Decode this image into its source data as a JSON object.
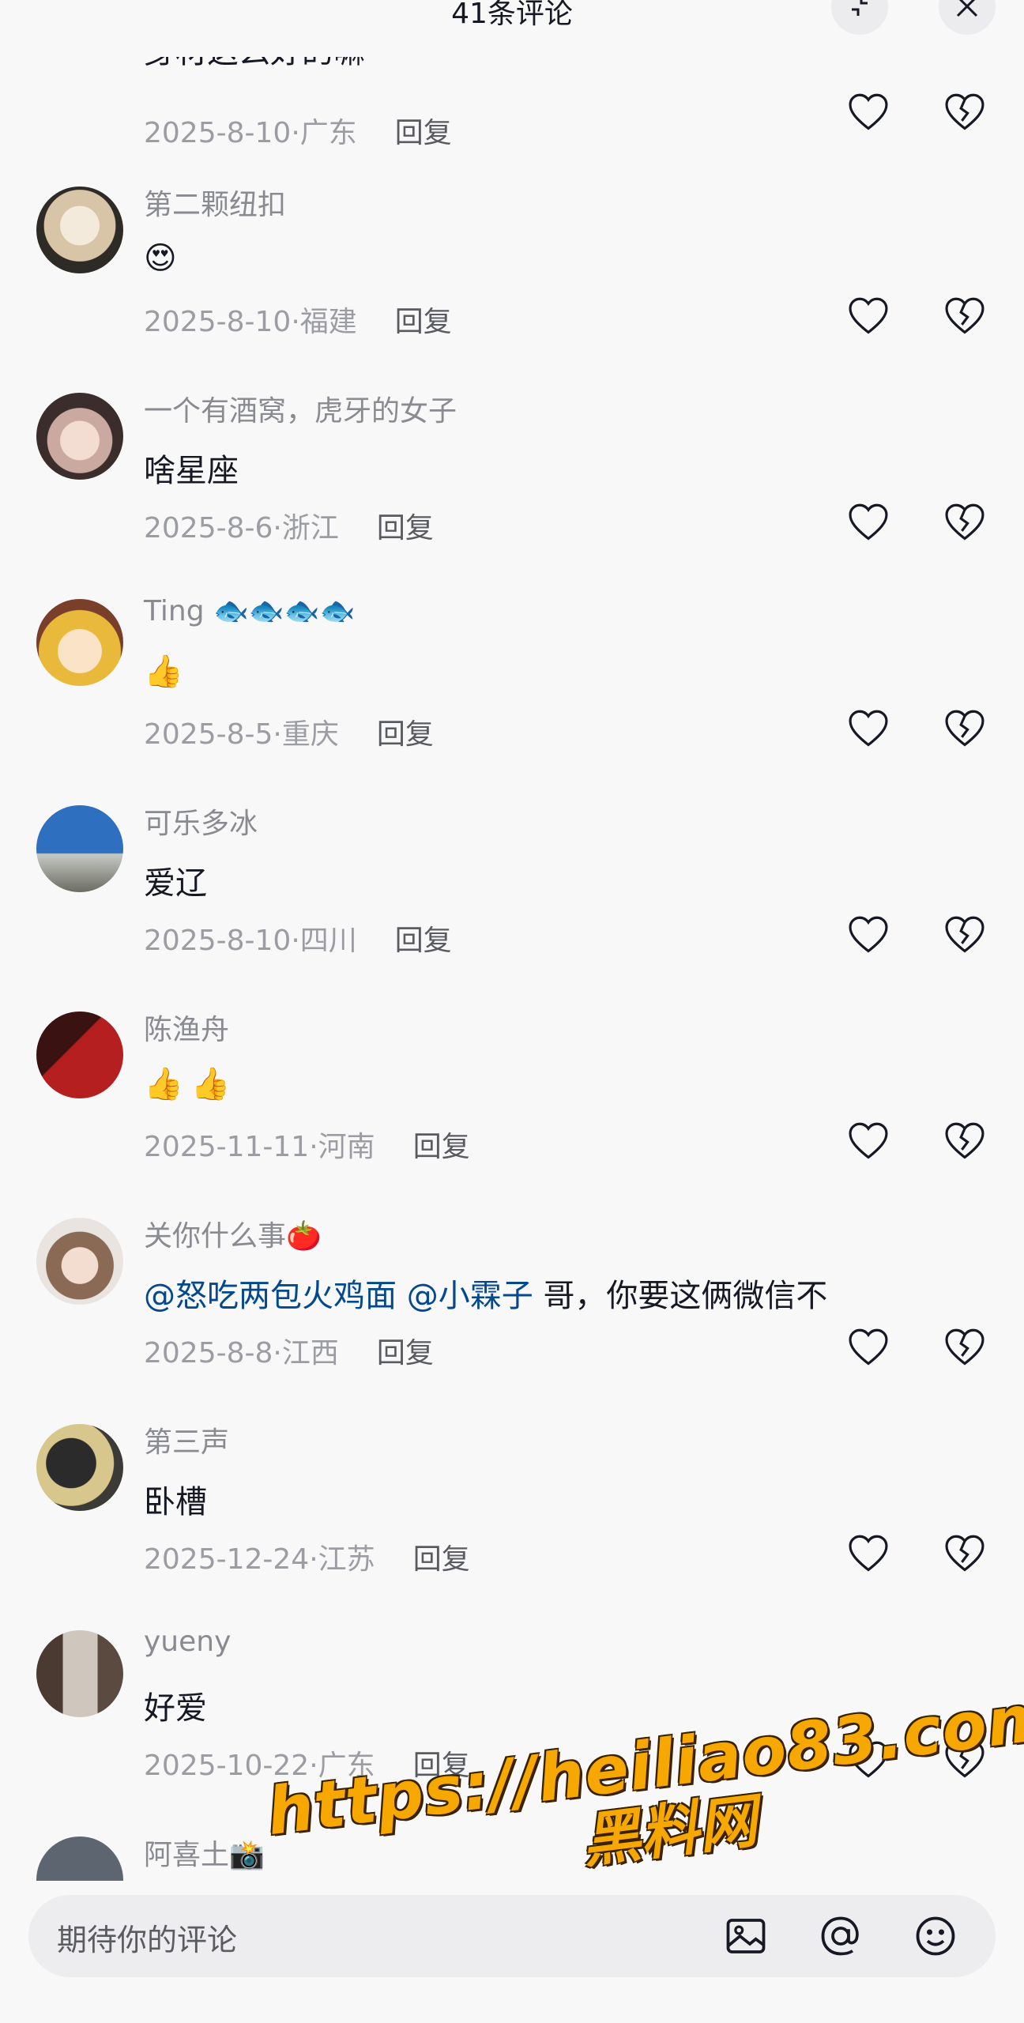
{
  "header": {
    "title": "41条评论"
  },
  "comments": [
    {
      "name": "",
      "text": "身材这么好的嘛",
      "date": "2025-8-10",
      "region": "广东",
      "reply": "回复"
    },
    {
      "name": "第二颗纽扣",
      "text": "",
      "emojis": [
        "😍"
      ],
      "date": "2025-8-10",
      "region": "福建",
      "reply": "回复"
    },
    {
      "name": "一个有酒窝，虎牙的女子",
      "text": "啥星座",
      "date": "2025-8-6",
      "region": "浙江",
      "reply": "回复"
    },
    {
      "name": "Ting 🐟🐟🐟🐟",
      "text": "",
      "emojis": [
        "👍"
      ],
      "date": "2025-8-5",
      "region": "重庆",
      "reply": "回复"
    },
    {
      "name": "可乐多冰",
      "text": "爱辽",
      "date": "2025-8-10",
      "region": "四川",
      "reply": "回复"
    },
    {
      "name": "陈渔舟",
      "text": "",
      "emojis": [
        "👍",
        "👍"
      ],
      "date": "2025-11-11",
      "region": "河南",
      "reply": "回复"
    },
    {
      "name": "关你什么事🍅",
      "mention1": "@怒吃两包火鸡面",
      "mention2": "@小霖子",
      "text": "哥，你要这俩微信不",
      "date": "2025-8-8",
      "region": "江西",
      "reply": "回复"
    },
    {
      "name": "第三声",
      "text": "卧槽",
      "date": "2025-12-24",
      "region": "江苏",
      "reply": "回复"
    },
    {
      "name": "yueny",
      "text": "好爱",
      "date": "2025-10-22",
      "region": "广东",
      "reply": "回复"
    },
    {
      "name": "阿喜土📸",
      "text": "",
      "date": "",
      "region": "",
      "reply": ""
    }
  ],
  "input": {
    "placeholder": "期待你的评论"
  },
  "watermark": {
    "url": "https://heiliao83.com",
    "name": "黑料网"
  },
  "colors": {
    "mention": "#04498d",
    "background": "#f8f8f9"
  }
}
